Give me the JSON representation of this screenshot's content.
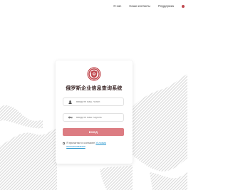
{
  "nav": {
    "about": "О нас",
    "contacts": "Наши контакты",
    "support": "Поддержка"
  },
  "login": {
    "title": "俄罗斯企业信息查询系统",
    "username_placeholder": "введите ваш логин",
    "password_placeholder": "введите ваш пароль",
    "submit_label": "вход",
    "consent_text": "Я прочитал и согласен",
    "consent_link": "Условия использования"
  },
  "icons": {
    "logo": "emblem-logo-icon",
    "user": "user-icon",
    "password": "key-icon",
    "language": "language-dot-icon"
  },
  "colors": {
    "accent": "#dc7c82",
    "brand": "#c0494f",
    "link": "#2e9ad0"
  }
}
